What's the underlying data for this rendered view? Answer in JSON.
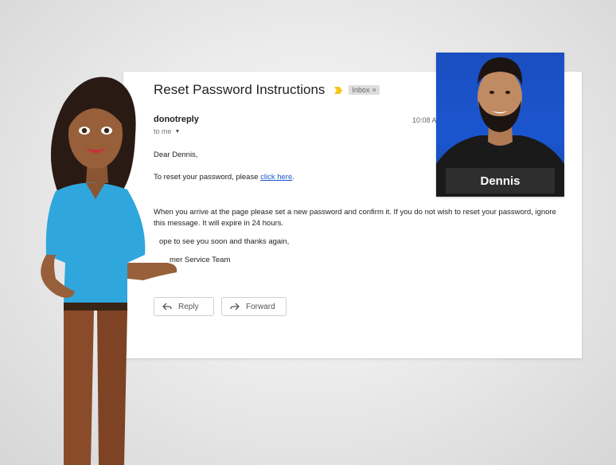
{
  "email": {
    "subject": "Reset Password Instructions",
    "label": "Inbox",
    "label_close": "×",
    "sender": "donotreply",
    "recipient": "to me",
    "time": "10:08 A",
    "greeting": "Dear Dennis,",
    "reset_line_prefix": "To reset your password, please ",
    "reset_link": "click here",
    "reset_line_suffix": ".",
    "instructions": "When you arrive at the page please set a new password and confirm it. If you do not wish to reset your password, ignore this message. It will expire in 24 hours.",
    "closing": "ope to see you soon and thanks again,",
    "signature": "mer Service Team"
  },
  "actions": {
    "reply_label": "Reply",
    "forward_label": "Forward"
  },
  "contact": {
    "name": "Dennis"
  },
  "icons": {
    "importance": "importance-marker-icon",
    "reply": "reply-arrow-icon",
    "forward": "forward-arrow-icon",
    "dropdown": "caret-down-icon"
  },
  "colors": {
    "link": "#1a55c8",
    "importance": "#f5c518",
    "contact_background": "#1b56d0"
  }
}
